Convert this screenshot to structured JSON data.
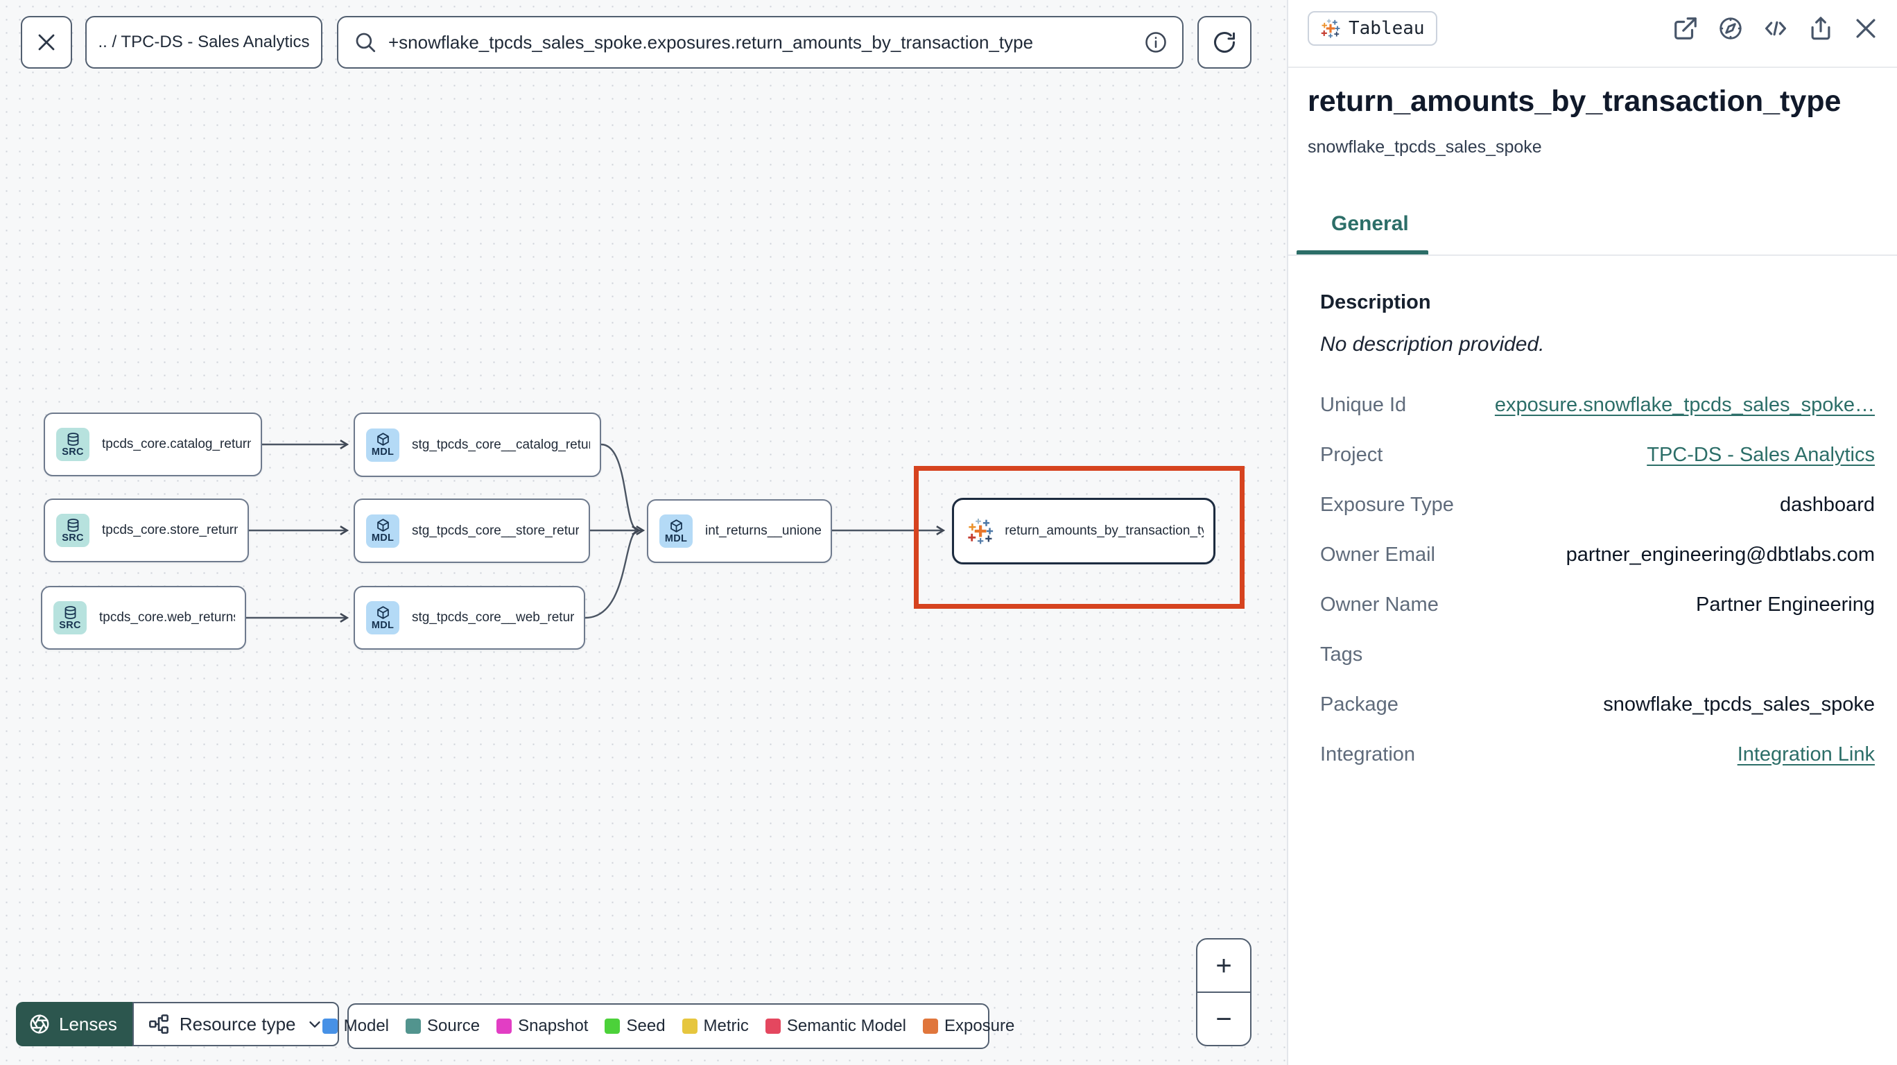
{
  "topbar": {
    "breadcrumb": ".. / TPC-DS - Sales Analytics",
    "search_value": "+snowflake_tpcds_sales_spoke.exposures.return_amounts_by_transaction_type"
  },
  "graph": {
    "nodes": [
      {
        "label": "tpcds_core.catalog_returns",
        "badge": "SRC",
        "type": "source"
      },
      {
        "label": "tpcds_core.store_returns",
        "badge": "SRC",
        "type": "source"
      },
      {
        "label": "tpcds_core.web_returns",
        "badge": "SRC",
        "type": "source"
      },
      {
        "label": "stg_tpcds_core__catalog_returns",
        "badge": "MDL",
        "type": "model"
      },
      {
        "label": "stg_tpcds_core__store_returns",
        "badge": "MDL",
        "type": "model"
      },
      {
        "label": "stg_tpcds_core__web_returns",
        "badge": "MDL",
        "type": "model"
      },
      {
        "label": "int_returns__unioned",
        "badge": "MDL",
        "type": "model"
      },
      {
        "label": "return_amounts_by_transaction_type",
        "type": "exposure"
      }
    ],
    "selected_node": "return_amounts_by_transaction_type"
  },
  "controls": {
    "lenses_label": "Lenses",
    "resource_type_label": "Resource type",
    "zoom_in": "+",
    "zoom_out": "−"
  },
  "legend": {
    "items": [
      {
        "label": "Model",
        "color": "#4791e6"
      },
      {
        "label": "Source",
        "color": "#52948e"
      },
      {
        "label": "Snapshot",
        "color": "#e23ec4"
      },
      {
        "label": "Seed",
        "color": "#4cd13a"
      },
      {
        "label": "Metric",
        "color": "#e6c63e"
      },
      {
        "label": "Semantic Model",
        "color": "#e4475f"
      },
      {
        "label": "Exposure",
        "color": "#e0763c"
      }
    ]
  },
  "panel": {
    "badge": "Tableau",
    "title": "return_amounts_by_transaction_type",
    "subtitle": "snowflake_tpcds_sales_spoke",
    "tab": "General",
    "description_label": "Description",
    "description_value": "No description provided.",
    "fields": [
      {
        "label": "Unique Id",
        "value": "exposure.snowflake_tpcds_sales_spoke…",
        "is_link": true
      },
      {
        "label": "Project",
        "value": "TPC-DS - Sales Analytics",
        "is_link": true
      },
      {
        "label": "Exposure Type",
        "value": "dashboard",
        "is_link": false
      },
      {
        "label": "Owner Email",
        "value": "partner_engineering@dbtlabs.com",
        "is_link": false
      },
      {
        "label": "Owner Name",
        "value": "Partner Engineering",
        "is_link": false
      },
      {
        "label": "Tags",
        "value": "",
        "is_link": false
      },
      {
        "label": "Package",
        "value": "snowflake_tpcds_sales_spoke",
        "is_link": false
      },
      {
        "label": "Integration",
        "value": "Integration Link",
        "is_link": true
      }
    ]
  },
  "icons": {
    "close": "x",
    "search": "magnifier",
    "info": "circle-i",
    "refresh": "rotate-cw",
    "lenses": "aperture",
    "resource_type": "network",
    "chevron": "chevron-down",
    "external_link": "arrow-out-of-box",
    "docs": "compass",
    "code": "angle-brackets",
    "share": "box-up-arrow",
    "source_node": "database",
    "model_node": "cube",
    "exposure_node": "tableau-logo"
  },
  "colors": {
    "accent_teal": "#2c6e68",
    "selection_red": "#d6431f",
    "lenses_green": "#2c564e",
    "source_badge_bg": "#b7e2de",
    "model_badge_bg": "#b4daf6",
    "canvas_bg": "#f7f8f9"
  }
}
